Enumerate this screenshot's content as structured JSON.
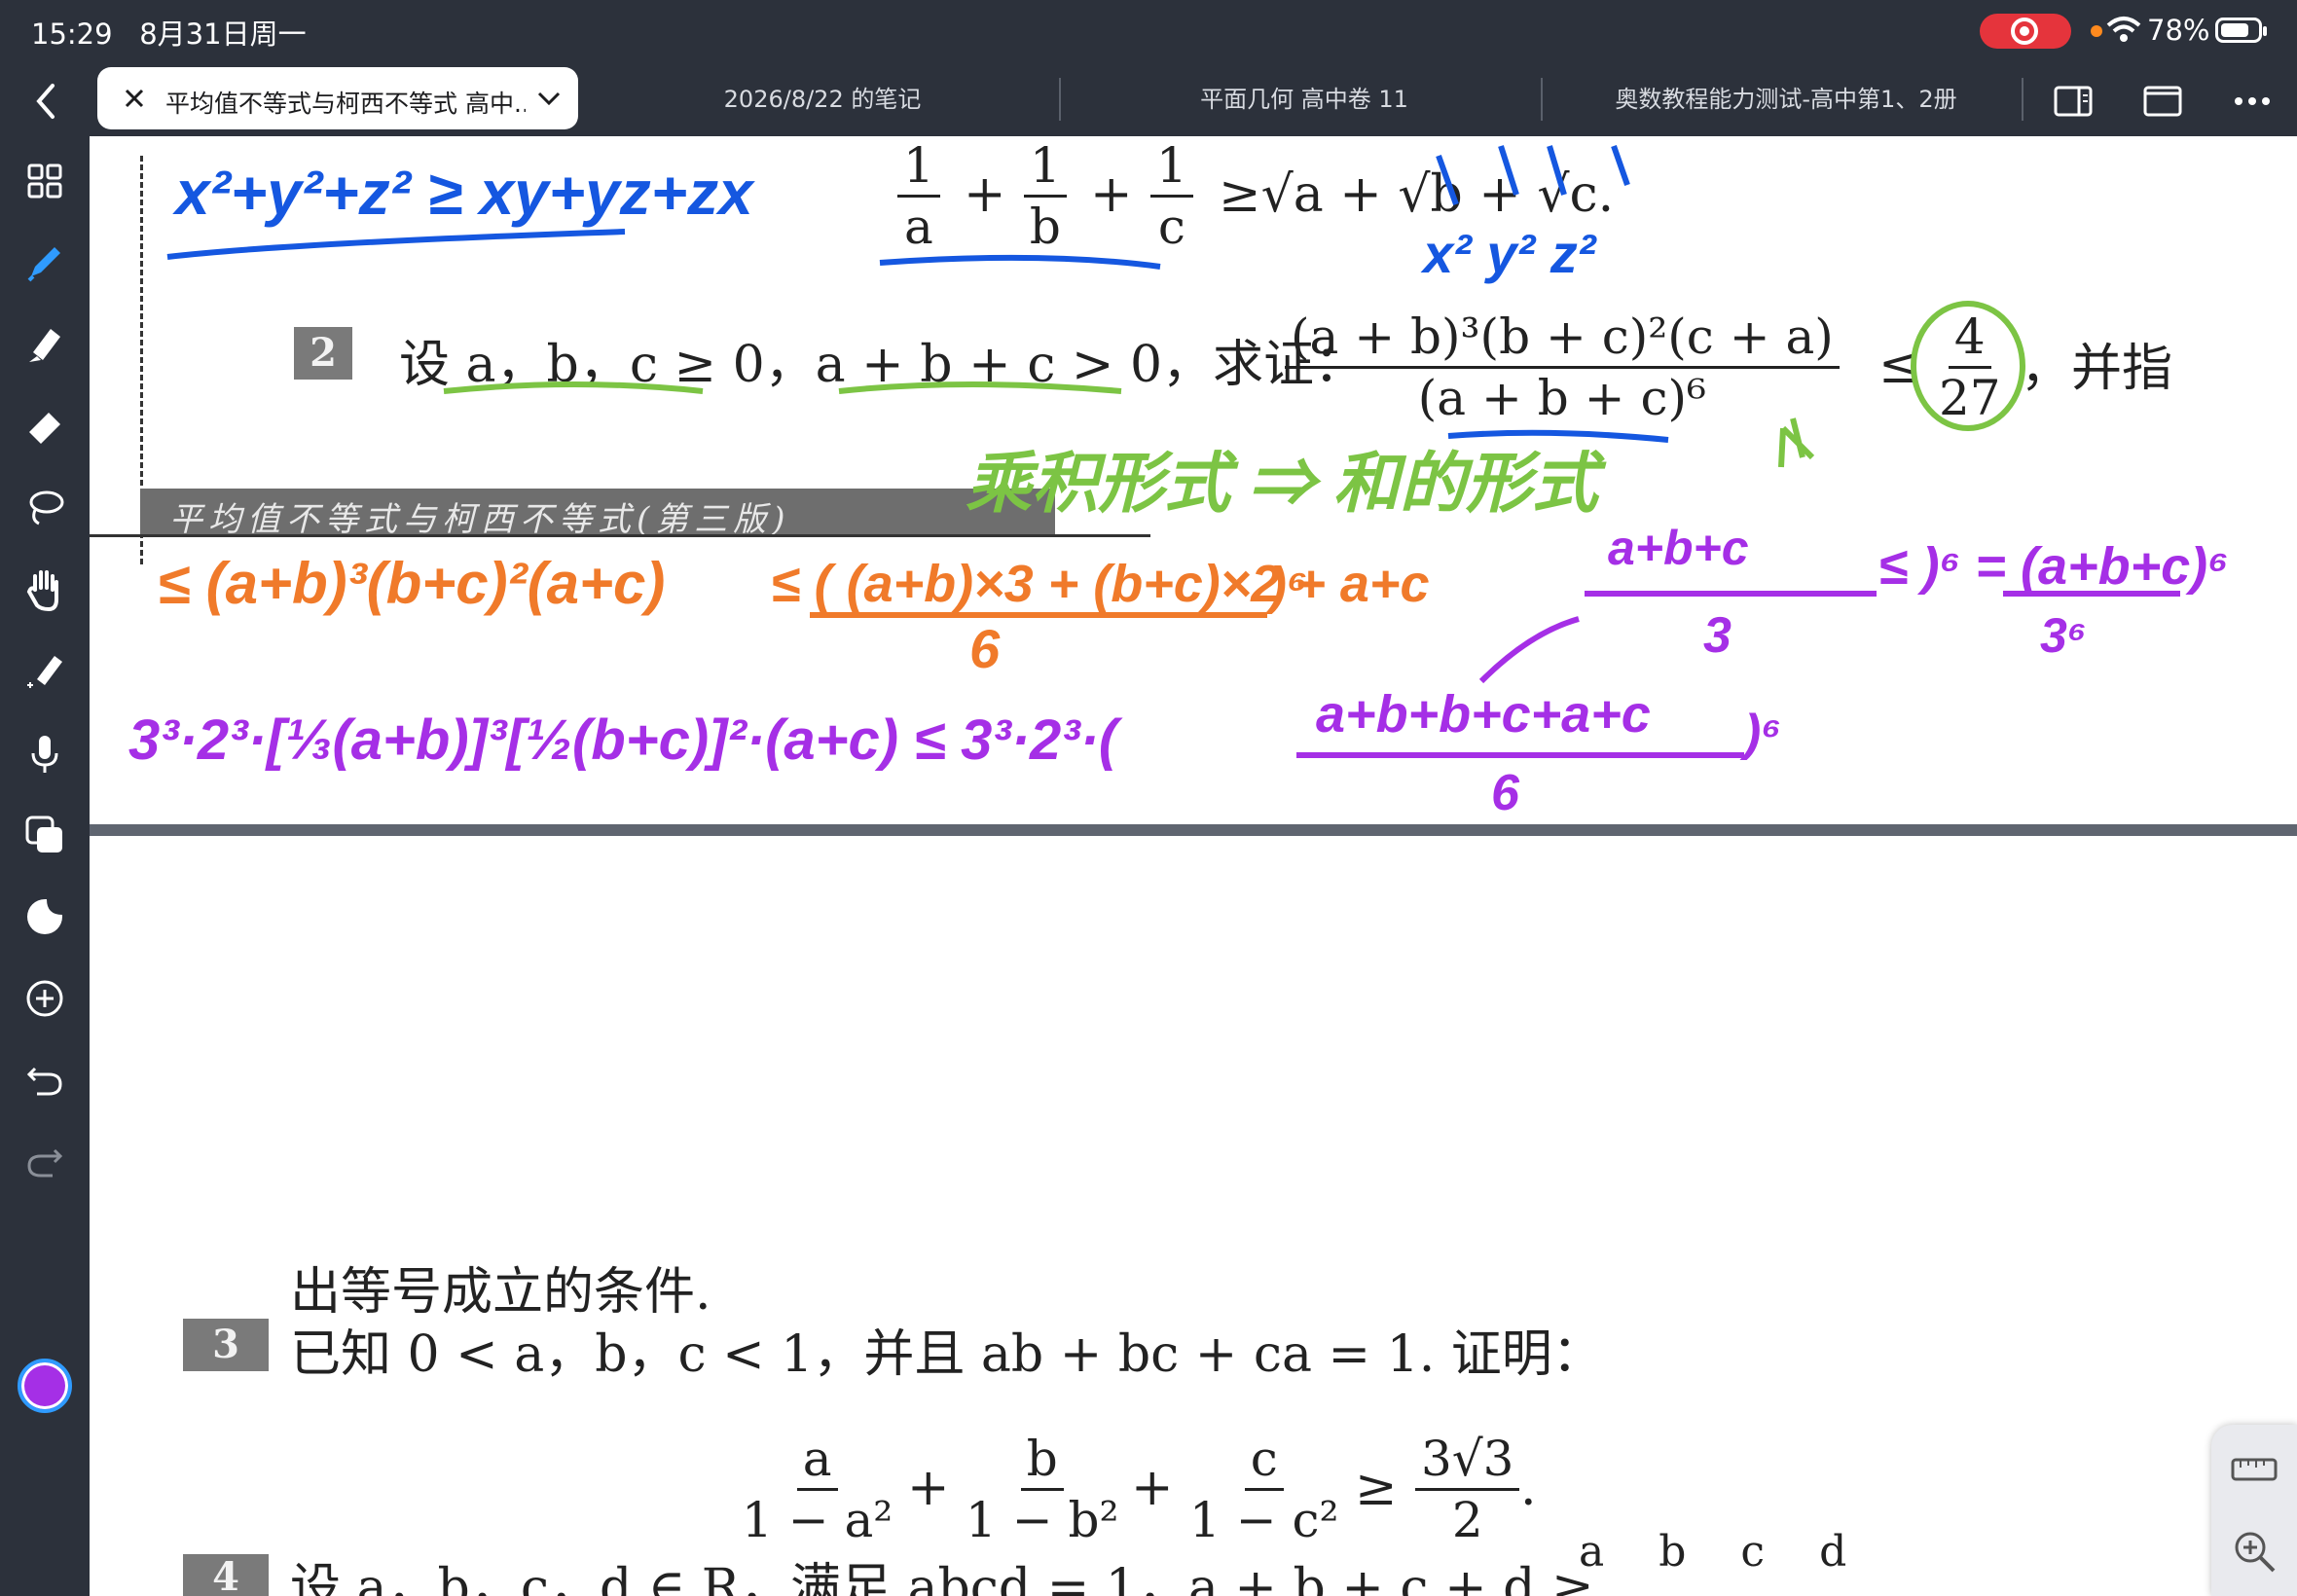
{
  "status_bar": {
    "time": "15:29",
    "date": "8月31日周一",
    "battery": "78%",
    "battery_level": 0.78,
    "recording_color": "#e5343c"
  },
  "tabs": {
    "active": "平均值不等式与柯西不等式 高中...",
    "others": [
      "2026/8/22 的笔记",
      "平面几何 高中卷 11",
      "奥数教程能力测试-高中第1、2册"
    ]
  },
  "toolbar_icons": [
    "sidebar-toggle-icon",
    "single-page-icon",
    "more-icon"
  ],
  "sidebar": {
    "tools": [
      "grid-icon",
      "pen-icon",
      "highlighter-icon",
      "eraser-icon",
      "lasso-icon",
      "hand-icon",
      "laser-pointer-icon",
      "microphone-icon",
      "shapes-icon",
      "sticker-icon",
      "add-icon",
      "undo-icon",
      "redo-icon"
    ],
    "selected_tool": "pen-icon",
    "selected_color": "#a52fe6"
  },
  "document": {
    "top": {
      "frac_parts": [
        "1",
        "a",
        "1",
        "b",
        "1",
        "c",
        "+",
        "+",
        "≥√a + √b + √c."
      ],
      "problem_number": "2",
      "problem_text": "设 a，b，c ≥ 0，a + b + c > 0，求证：",
      "main_frac_num": "(a + b)³(b + c)²(c + a)",
      "main_frac_den": "(a + b + c)⁶",
      "leq": "≤",
      "frac_4": "4",
      "frac_27": "27",
      "tail": "，并指",
      "banner": "平均值不等式与柯西不等式(第三版)"
    },
    "bottom": {
      "cont": "出等号成立的条件.",
      "p3_number": "3",
      "p3_text": "已知 0 < a，b，c < 1，并且 ab + bc + ca = 1. 证明：",
      "p3_fracs": [
        {
          "n": "a",
          "d": "1 − a²"
        },
        {
          "n": "b",
          "d": "1 − b²"
        },
        {
          "n": "c",
          "d": "1 − c²"
        }
      ],
      "plus": "+",
      "geq": "≥",
      "rhs_n": "3√3",
      "rhs_d": "2",
      "period": ".",
      "p4_number": "4",
      "p4_text": "设 a，b，c，d ∈ R，满足 abcd = 1，a + b + c + d ≥",
      "p4_tail": [
        "a",
        "b",
        "c",
        "d"
      ]
    },
    "handwriting": {
      "blue_1": "x²+y²+z² ≥ xy+yz+zx",
      "blue_2": "x²  y²  z²",
      "green_1": "乘积形式 ⇒ 和的形式",
      "orange_1": "≤ (a+b)³(b+c)²(a+c)",
      "orange_2": "≤ ( (a+b)×3 + (b+c)×2 + a+c",
      "orange_3": "6",
      "orange_4": ")⁶",
      "purple_1": "a+b+c",
      "purple_2": "3",
      "purple_3": "≤ )⁶ = (a+b+c)⁶",
      "purple_4": "3⁶",
      "purple_5": "3³·2³·[⅓(a+b)]³[½(b+c)]²·(a+c) ≤ 3³·2³·(",
      "purple_6": "a+b+b+c+a+c",
      "purple_7": "6",
      "purple_8": ")⁶",
      "colors": {
        "blue": "#1557e0",
        "green": "#7cc444",
        "orange": "#f07a2a",
        "purple": "#a52fe6"
      }
    }
  }
}
